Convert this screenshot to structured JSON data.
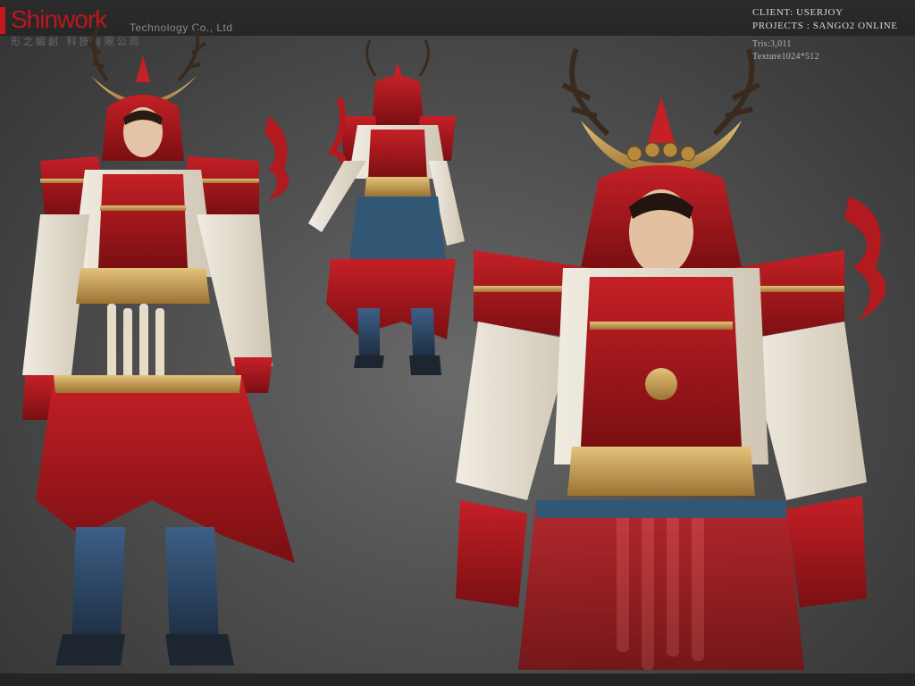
{
  "branding": {
    "logo_text": "Shinwork",
    "logo_subtitle": "Technology Co., Ltd",
    "logo_chinese": "形之鍛創 科技有限公司",
    "accent_color": "#c8161e"
  },
  "info": {
    "client": "CLIENT: USERJOY",
    "projects": "PROJECTS : SANGO2 ONLINE",
    "tris": "Tris:3,011",
    "texture": "Texture1024*512"
  },
  "colors": {
    "armor_red": "#a5161b",
    "gold_trim": "#c79b4a",
    "robe_white": "#e8e2d6",
    "steel_blue": "#2f4a6a",
    "background_gray": "#555555"
  }
}
